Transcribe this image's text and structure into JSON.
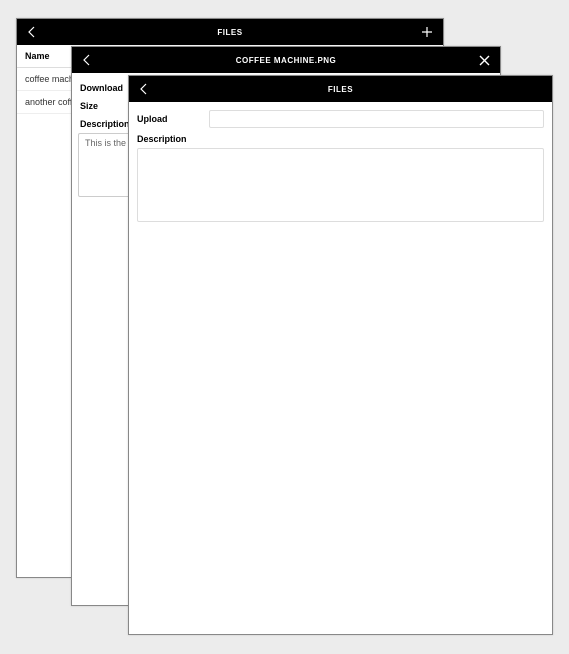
{
  "window1": {
    "title": "FILES",
    "columns": [
      "Name"
    ],
    "rows": [
      {
        "name": "coffee machine"
      },
      {
        "name": "another coffee"
      }
    ]
  },
  "window2": {
    "title": "COFFEE MACHINE.PNG",
    "labels": {
      "download": "Download",
      "size": "Size",
      "description": "Description"
    },
    "description_value": "This is the fi"
  },
  "window3": {
    "title": "FILES",
    "labels": {
      "upload": "Upload",
      "description": "Description"
    }
  }
}
